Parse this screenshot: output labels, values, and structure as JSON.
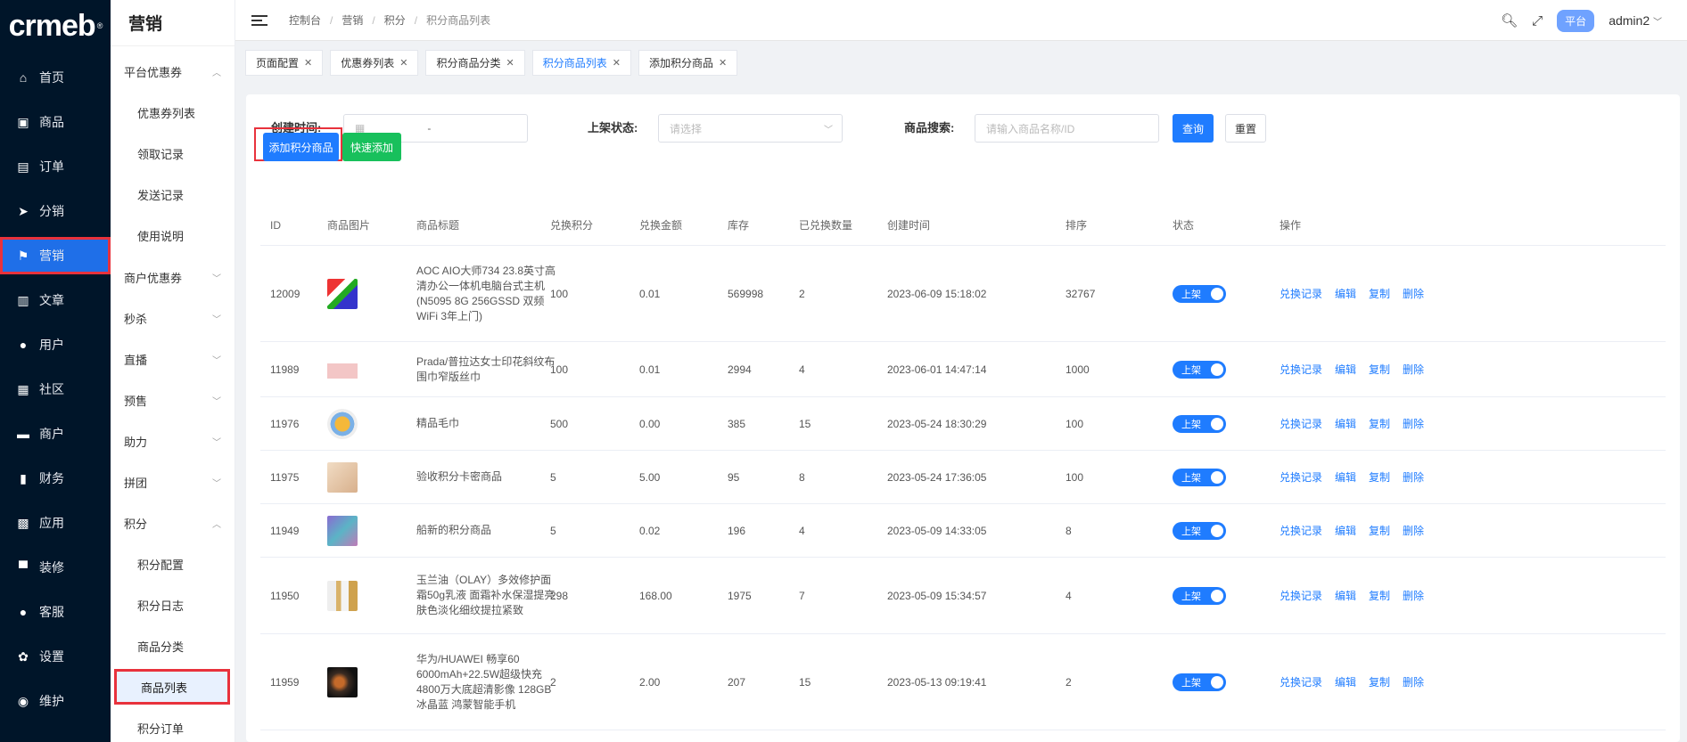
{
  "logo": "crmeb",
  "sidebar": {
    "items": [
      {
        "label": "首页",
        "icon": "home-icon",
        "glyph": "⌂"
      },
      {
        "label": "商品",
        "icon": "bag-icon",
        "glyph": "▣"
      },
      {
        "label": "订单",
        "icon": "order-icon",
        "glyph": "▤"
      },
      {
        "label": "分销",
        "icon": "send-icon",
        "glyph": "➤"
      },
      {
        "label": "营销",
        "icon": "flag-icon",
        "glyph": "⚑"
      },
      {
        "label": "文章",
        "icon": "article-icon",
        "glyph": "▥"
      },
      {
        "label": "用户",
        "icon": "user-icon",
        "glyph": "●"
      },
      {
        "label": "社区",
        "icon": "community-icon",
        "glyph": "▦"
      },
      {
        "label": "商户",
        "icon": "merchant-icon",
        "glyph": "▬"
      },
      {
        "label": "财务",
        "icon": "finance-icon",
        "glyph": "▮"
      },
      {
        "label": "应用",
        "icon": "apps-icon",
        "glyph": "▩"
      },
      {
        "label": "装修",
        "icon": "decorate-icon",
        "glyph": "▀"
      },
      {
        "label": "客服",
        "icon": "service-icon",
        "glyph": "●"
      },
      {
        "label": "设置",
        "icon": "settings-icon",
        "glyph": "✿"
      },
      {
        "label": "维护",
        "icon": "maintain-icon",
        "glyph": "◉"
      }
    ]
  },
  "submenu": {
    "title": "营销",
    "items": [
      {
        "label": "平台优惠券",
        "type": "group",
        "chev": "︿"
      },
      {
        "label": "优惠券列表",
        "type": "leaf"
      },
      {
        "label": "领取记录",
        "type": "leaf"
      },
      {
        "label": "发送记录",
        "type": "leaf"
      },
      {
        "label": "使用说明",
        "type": "leaf"
      },
      {
        "label": "商户优惠券",
        "type": "group",
        "chev": "﹀"
      },
      {
        "label": "秒杀",
        "type": "group",
        "chev": "﹀"
      },
      {
        "label": "直播",
        "type": "group",
        "chev": "﹀"
      },
      {
        "label": "预售",
        "type": "group",
        "chev": "﹀"
      },
      {
        "label": "助力",
        "type": "group",
        "chev": "﹀"
      },
      {
        "label": "拼团",
        "type": "group",
        "chev": "﹀"
      },
      {
        "label": "积分",
        "type": "group",
        "chev": "︿"
      },
      {
        "label": "积分配置",
        "type": "leaf"
      },
      {
        "label": "积分日志",
        "type": "leaf"
      },
      {
        "label": "商品分类",
        "type": "leaf"
      },
      {
        "label": "商品列表",
        "type": "leaf"
      },
      {
        "label": "积分订单",
        "type": "leaf"
      }
    ]
  },
  "header": {
    "breadcrumb": [
      "控制台",
      "营销",
      "积分",
      "积分商品列表"
    ],
    "platform": "平台",
    "user": "admin2"
  },
  "tags": [
    {
      "label": "页面配置"
    },
    {
      "label": "优惠券列表"
    },
    {
      "label": "积分商品分类"
    },
    {
      "label": "积分商品列表"
    },
    {
      "label": "添加积分商品"
    }
  ],
  "filters": {
    "created_label": "创建时间:",
    "date_sep": "-",
    "status_label": "上架状态:",
    "status_placeholder": "请选择",
    "search_label": "商品搜索:",
    "search_placeholder": "请输入商品名称/ID",
    "query_btn": "查询",
    "reset_btn": "重置"
  },
  "actions": {
    "add_btn": "添加积分商品",
    "quick_add_btn": "快速添加"
  },
  "table": {
    "columns": [
      "ID",
      "商品图片",
      "商品标题",
      "兑换积分",
      "兑换金额",
      "库存",
      "已兑换数量",
      "创建时间",
      "排序",
      "状态",
      "操作"
    ],
    "status_label": "上架",
    "ops": [
      "兑换记录",
      "编辑",
      "复制",
      "删除"
    ],
    "rows": [
      {
        "id": "12009",
        "title": "AOC AIO大师734 23.8英寸高清办公一体机电脑台式主机(N5095 8G 256GSSD 双频WiFi 3年上门)",
        "points": "100",
        "amount": "0.01",
        "stock": "569998",
        "sold": "2",
        "created": "2023-06-09 15:18:02",
        "sort": "32767"
      },
      {
        "id": "11989",
        "title": "Prada/普拉达女士印花斜纹布围巾窄版丝巾",
        "points": "100",
        "amount": "0.01",
        "stock": "2994",
        "sold": "4",
        "created": "2023-06-01 14:47:14",
        "sort": "1000"
      },
      {
        "id": "11976",
        "title": "精品毛巾",
        "points": "500",
        "amount": "0.00",
        "stock": "385",
        "sold": "15",
        "created": "2023-05-24 18:30:29",
        "sort": "100"
      },
      {
        "id": "11975",
        "title": "验收积分卡密商品",
        "points": "5",
        "amount": "5.00",
        "stock": "95",
        "sold": "8",
        "created": "2023-05-24 17:36:05",
        "sort": "100"
      },
      {
        "id": "11949",
        "title": "船新的积分商品",
        "points": "5",
        "amount": "0.02",
        "stock": "196",
        "sold": "4",
        "created": "2023-05-09 14:33:05",
        "sort": "8"
      },
      {
        "id": "11950",
        "title": "玉兰油（OLAY）多效修护面霜50g乳液 面霜补水保湿提亮肤色淡化细纹提拉紧致",
        "points": "298",
        "amount": "168.00",
        "stock": "1975",
        "sold": "7",
        "created": "2023-05-09 15:34:57",
        "sort": "4"
      },
      {
        "id": "11959",
        "title": "华为/HUAWEI 畅享60 6000mAh+22.5W超级快充 4800万大底超清影像 128GB 冰晶蓝 鸿蒙智能手机",
        "points": "2",
        "amount": "2.00",
        "stock": "207",
        "sold": "15",
        "created": "2023-05-13 09:19:41",
        "sort": "2"
      }
    ]
  }
}
